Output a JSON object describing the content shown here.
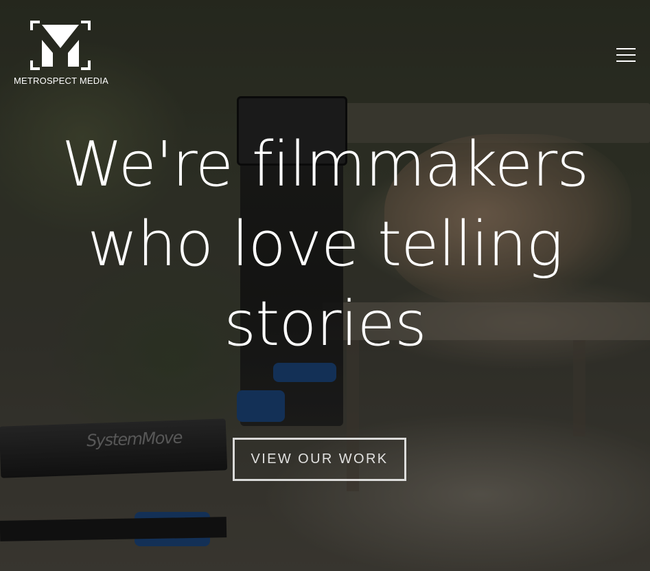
{
  "header": {
    "logo_name": "METROSPECT MEDIA",
    "menu_icon": "hamburger-menu-icon"
  },
  "hero": {
    "headline_lines": [
      "We're filmmakers",
      "who love telling",
      "stories"
    ],
    "cta_label": "VIEW OUR WORK",
    "camera_rail_brand": "SystemMove"
  },
  "colors": {
    "text": "#ffffff",
    "overlay": "rgba(0,0,0,0.38)",
    "cta_border": "#ffffff"
  }
}
